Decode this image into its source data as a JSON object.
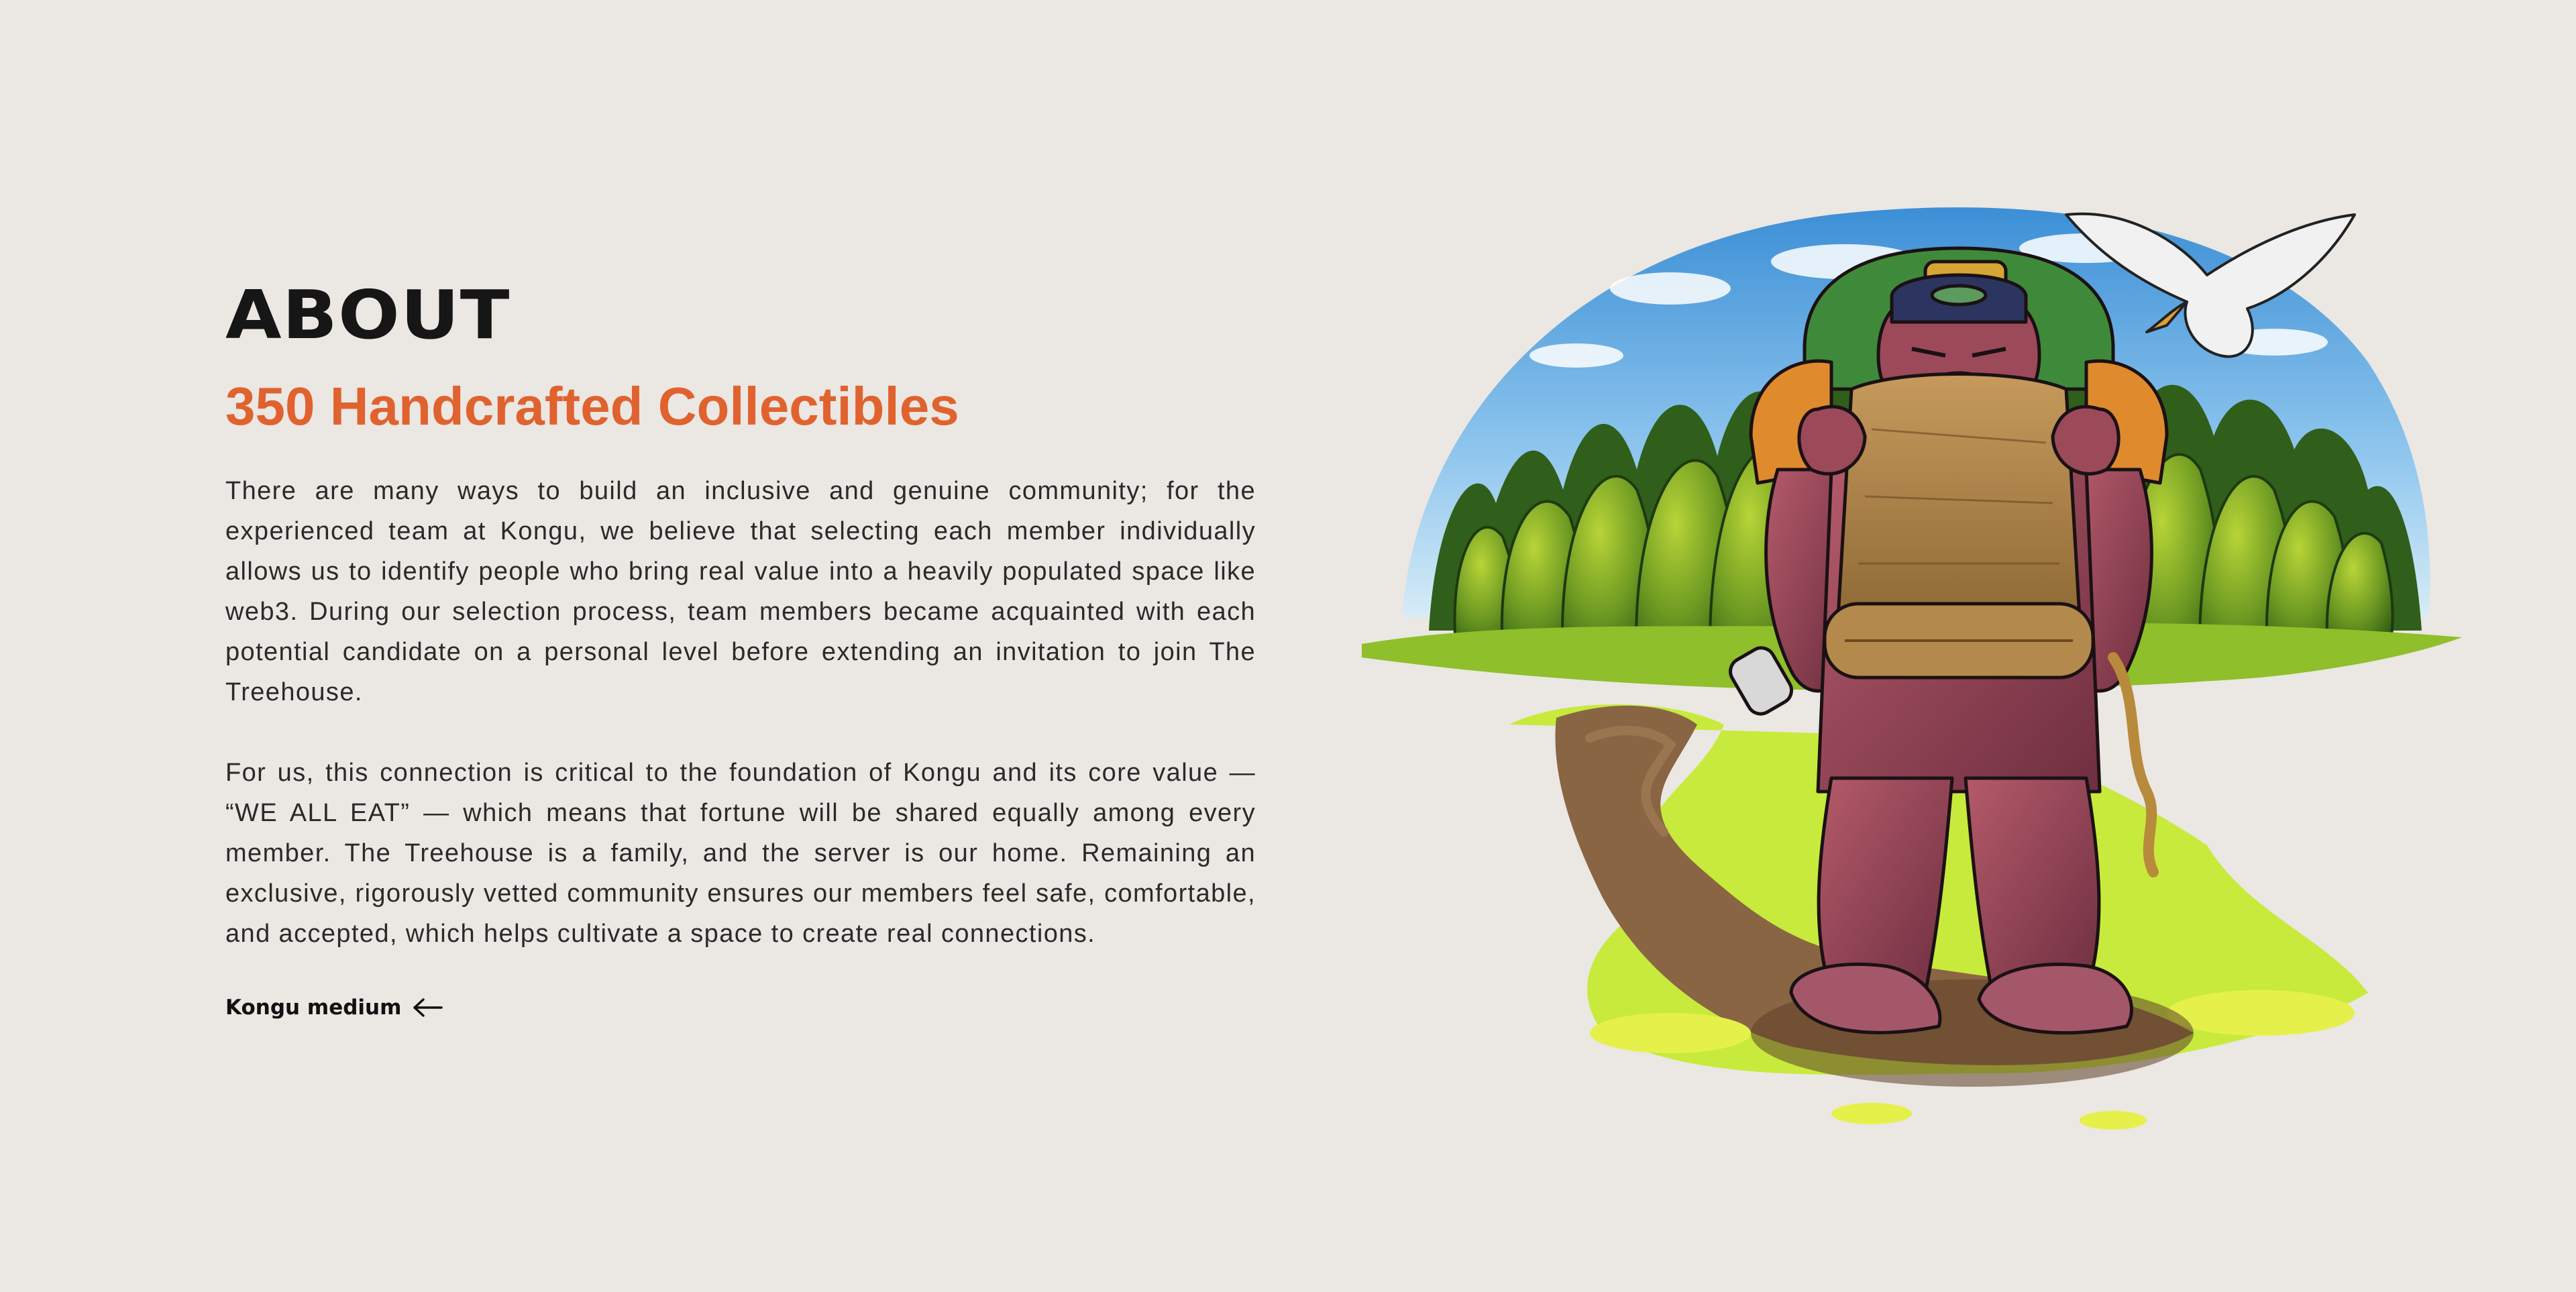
{
  "about": {
    "heading": "ABOUT",
    "subheading": "350 Handcrafted Collectibles",
    "paragraph_1": "There are many ways to build an inclusive and genuine community; for the experienced team at Kongu, we believe that selecting each member individually allows us to identify people who bring real value into a heavily populated space like web3. During our selection process, team members became acquainted with each potential candidate on a personal level before extending an invitation to join The Treehouse.",
    "paragraph_2": "For us, this connection is critical to the foundation of Kongu and its core value — “WE ALL EAT” — which means that fortune will be shared equally among every member. The Treehouse is a family, and the server is our home. Remaining an exclusive, rigorously vetted community ensures our members feel safe, comfortable, and accepted, which helps cultivate a space to create real connections.",
    "link_label": "Kongu medium",
    "link_icon": "arrow-left-icon"
  },
  "illustration": {
    "subject": "kongu-gorilla-hiker-illustration"
  },
  "colors": {
    "background": "#ebe7e3",
    "accent": "#e0622f",
    "heading": "#161616"
  }
}
